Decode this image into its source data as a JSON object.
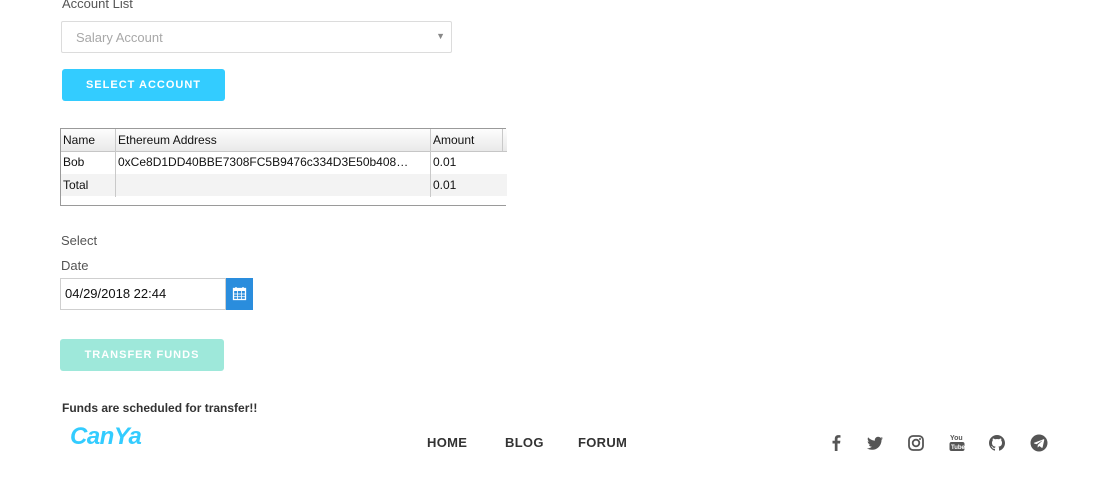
{
  "account_section": {
    "label": "Account List",
    "select_value": "Salary Account",
    "select_button": "SELECT ACCOUNT"
  },
  "grid": {
    "columns": [
      "Name",
      "Ethereum Address",
      "Amount"
    ],
    "rows": [
      {
        "name": "Bob",
        "address": "0xCe8D1DD40BBE7308FC5B9476c334D3E50b408…",
        "amount": "0.01"
      },
      {
        "name": "Total",
        "address": "",
        "amount": "0.01"
      }
    ]
  },
  "date_section": {
    "label_select": "Select",
    "label_date": "Date",
    "date_value": "04/29/2018 22:44"
  },
  "transfer_button": "TRANSFER FUNDS",
  "status_message": "Funds are scheduled for transfer!!",
  "footer": {
    "logo": "CanYa",
    "nav": [
      "HOME",
      "BLOG",
      "FORUM"
    ],
    "social_icons": [
      "facebook-icon",
      "twitter-icon",
      "instagram-icon",
      "youtube-icon",
      "github-icon",
      "telegram-icon"
    ]
  },
  "colors": {
    "primary": "#33ccff",
    "transfer_disabled": "#9ee8da",
    "calendar": "#2a8ddd"
  }
}
